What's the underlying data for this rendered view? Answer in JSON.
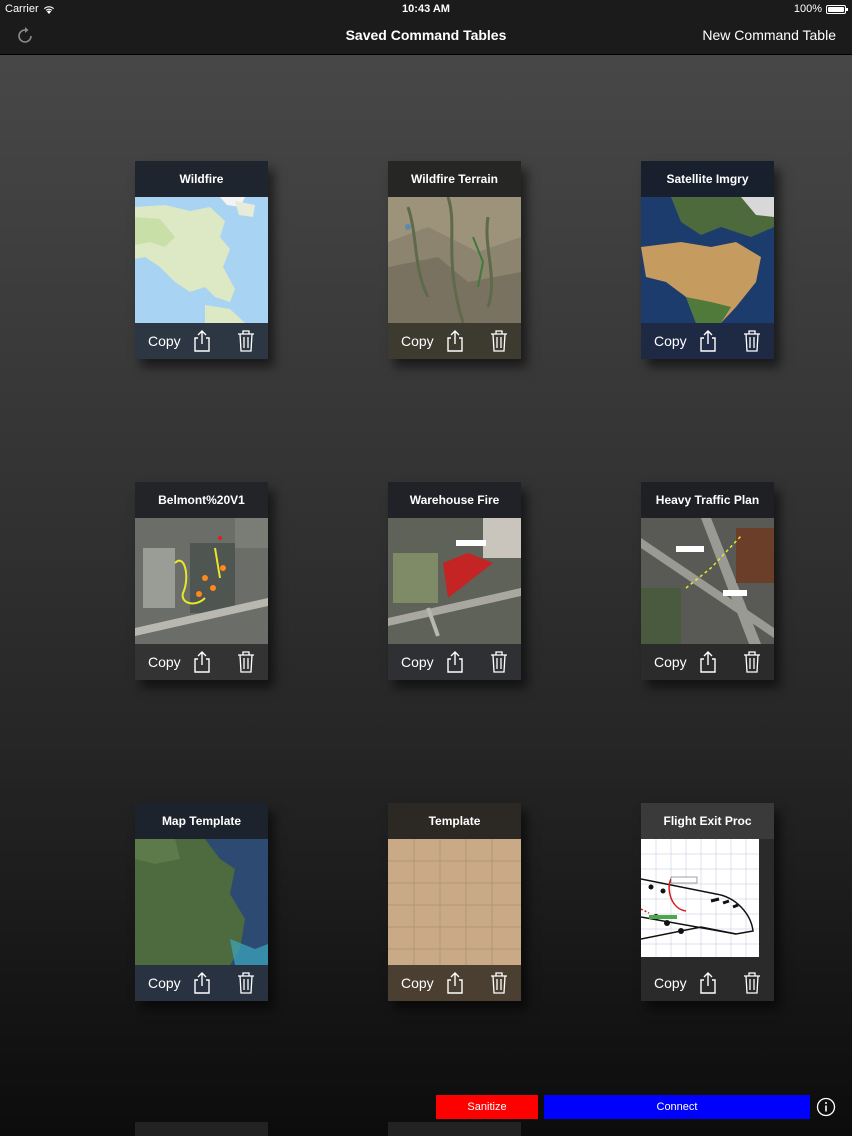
{
  "status_bar": {
    "carrier": "Carrier",
    "time": "10:43 AM",
    "battery": "100%"
  },
  "nav": {
    "title": "Saved Command Tables",
    "new_button": "New Command Table",
    "refresh_icon": "refresh-icon"
  },
  "cards": [
    {
      "title": "Wildfire",
      "thumb": "map-north-america"
    },
    {
      "title": "Wildfire Terrain",
      "thumb": "satellite-terrain"
    },
    {
      "title": "Satellite Imgry",
      "thumb": "satellite-europe-africa"
    },
    {
      "title": "Belmont%20V1",
      "thumb": "aerial-annotated"
    },
    {
      "title": "Warehouse Fire",
      "thumb": "aerial-fire-zone"
    },
    {
      "title": "Heavy Traffic Plan",
      "thumb": "aerial-intersection"
    },
    {
      "title": "Map Template",
      "thumb": "satellite-east-coast"
    },
    {
      "title": "Template",
      "thumb": "grid-template"
    },
    {
      "title": "Flight Exit Proc",
      "thumb": "aircraft-diagram"
    }
  ],
  "card_actions": {
    "copy": "Copy",
    "share_icon": "share-icon",
    "trash_icon": "trash-icon"
  },
  "footer": {
    "sanitize": "Sanitize",
    "connect": "Connect",
    "info_icon": "info-icon"
  },
  "colors": {
    "sanitize": "#ff0000",
    "connect": "#0000ff",
    "navbar": "#1b1b1b"
  }
}
